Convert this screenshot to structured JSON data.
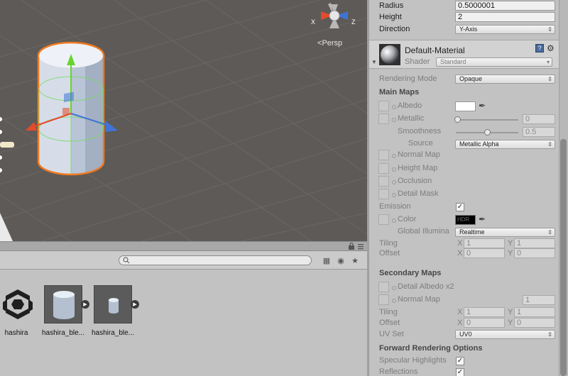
{
  "scene": {
    "persp_label": "Persp",
    "gizmo_axes": {
      "x": "X",
      "z": "Z"
    },
    "colors": {
      "background": "#5e5a57",
      "grid": "#6d6966",
      "selection_outline": "#f07a20",
      "axis_x": "#e34b2a",
      "axis_y": "#6ad330",
      "axis_z": "#3f74d6"
    }
  },
  "project": {
    "search": {
      "placeholder": "",
      "value": ""
    },
    "assets": [
      {
        "label": "hashira",
        "icon": "unity-logo-icon"
      },
      {
        "label": "hashira_ble...",
        "icon": "cylinder-mesh-icon"
      },
      {
        "label": "hashira_ble...",
        "icon": "cylinder-small-icon"
      }
    ]
  },
  "inspector": {
    "collider": {
      "radius_label": "Radius",
      "radius_value": "0.5000001",
      "height_label": "Height",
      "height_value": "2",
      "direction_label": "Direction",
      "direction_value": "Y-Axis"
    },
    "material": {
      "name": "Default-Material",
      "shader_label": "Shader",
      "shader_value": "Standard",
      "rendering_mode_label": "Rendering Mode",
      "rendering_mode_value": "Opaque",
      "main_maps_header": "Main Maps",
      "albedo_label": "Albedo",
      "metallic_label": "Metallic",
      "metallic_value": "0",
      "metallic_level": 0,
      "smoothness_label": "Smoothness",
      "smoothness_value": "0.5",
      "smoothness_level": 0.5,
      "source_label": "Source",
      "source_value": "Metallic Alpha",
      "normal_map_label": "Normal Map",
      "height_map_label": "Height Map",
      "occlusion_label": "Occlusion",
      "detail_mask_label": "Detail Mask",
      "emission_label": "Emission",
      "emission_checked": true,
      "color_label": "Color",
      "hdr_label": "HDR",
      "global_illum_label": "Global Illumina",
      "global_illum_value": "Realtime",
      "tiling_label": "Tiling",
      "offset_label": "Offset",
      "tiling_x": "1",
      "tiling_y": "1",
      "offset_x": "0",
      "offset_y": "0",
      "axis_x": "X",
      "axis_y": "Y",
      "secondary_maps_header": "Secondary Maps",
      "detail_albedo_label": "Detail Albedo x2",
      "normal_map2_label": "Normal Map",
      "normal_map2_value": "1",
      "tiling2_x": "1",
      "tiling2_y": "1",
      "offset2_x": "0",
      "offset2_y": "0",
      "uv_set_label": "UV Set",
      "uv_set_value": "UV0",
      "forward_header": "Forward Rendering Options",
      "specular_label": "Specular Highlights",
      "specular_checked": true,
      "reflections_label": "Reflections",
      "reflections_checked": true,
      "albedo_color": "#ffffff",
      "emission_color": "#000000"
    }
  }
}
